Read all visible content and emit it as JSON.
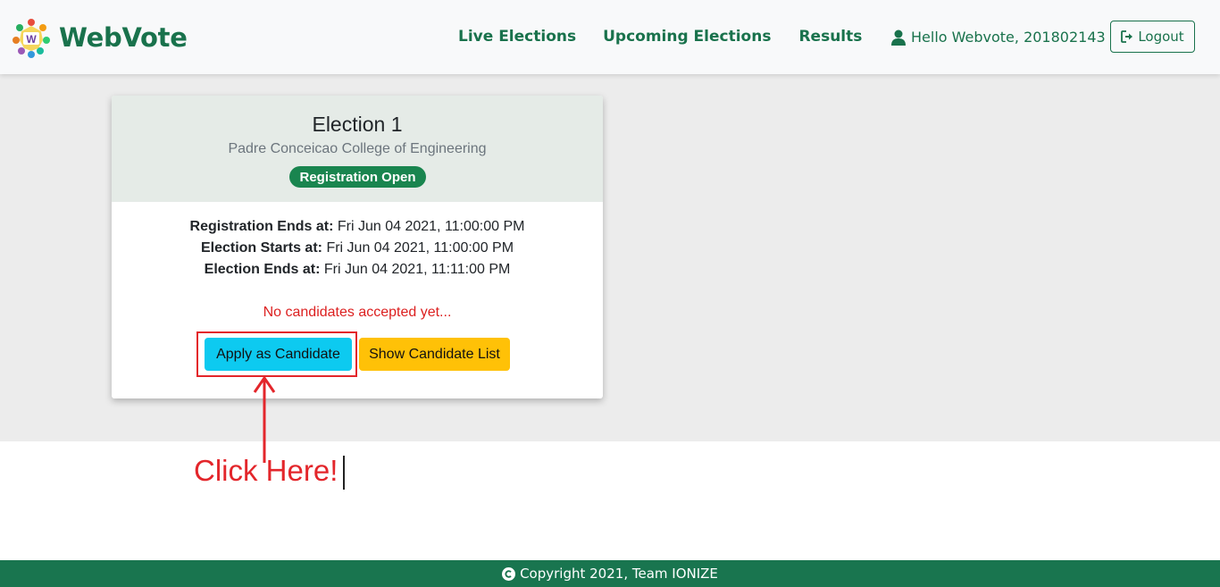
{
  "brand": {
    "name": "WebVote",
    "logo_icon": "webvote-logo-icon"
  },
  "nav": {
    "links": [
      "Live Elections",
      "Upcoming Elections",
      "Results"
    ],
    "user_greeting": "Hello Webvote, 201802143",
    "logout_label": "Logout"
  },
  "election": {
    "title": "Election 1",
    "institution": "Padre Conceicao College of Engineering",
    "status": "Registration Open",
    "registration_ends_label": "Registration Ends at:",
    "registration_ends_value": "Fri Jun 04 2021, 11:00:00 PM",
    "election_starts_label": "Election Starts at:",
    "election_starts_value": "Fri Jun 04 2021, 11:00:00 PM",
    "election_ends_label": "Election Ends at:",
    "election_ends_value": "Fri Jun 04 2021, 11:11:00 PM",
    "no_candidates_text": "No candidates accepted yet...",
    "apply_label": "Apply as Candidate",
    "show_list_label": "Show Candidate List"
  },
  "annotation": {
    "callout_text": "Click Here!"
  },
  "footer": {
    "copyright": "Copyright 2021, Team IONIZE"
  },
  "colors": {
    "brand_green": "#19724c",
    "badge_green": "#19854f",
    "apply_cyan": "#0dcaf0",
    "show_yellow": "#ffc107",
    "annotation_red": "#e3262b",
    "footer_green": "#19754f"
  }
}
